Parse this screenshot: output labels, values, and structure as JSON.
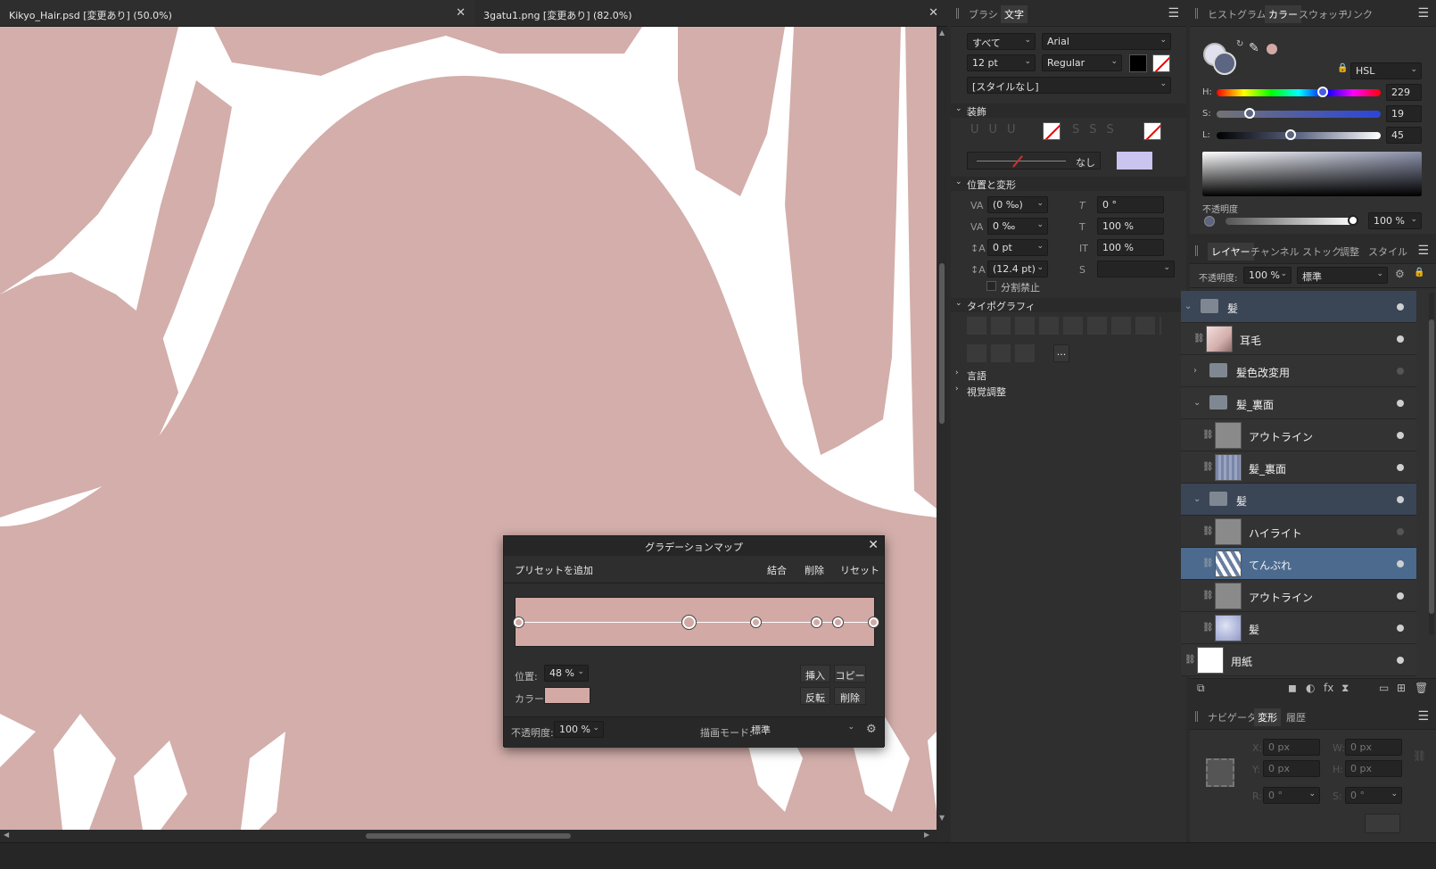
{
  "tabs": [
    {
      "label": "Kikyo_Hair.psd [変更あり] (50.0%)",
      "close": "✕"
    },
    {
      "label": "3gatu1.png [変更あり] (82.0%)",
      "close": "✕"
    }
  ],
  "canvas": {
    "shape_color": "#d3aeaa",
    "bg_color": "#ffffff"
  },
  "text_panel": {
    "tabs": [
      "ブラシ",
      "文字"
    ],
    "active_tab": "文字",
    "scope": "すべて",
    "font": "Arial",
    "size": "12 pt",
    "style": "Regular",
    "paragraph_style": "[スタイルなし]",
    "decoration_header": "装飾",
    "none_label": "なし",
    "position_header": "位置と変形",
    "kerning": "(0 ‰)",
    "tracking": "0 ‰",
    "baseline": "0 pt",
    "leading": "(12.4 pt)",
    "skew": "0 °",
    "hscale": "100 %",
    "vscale": "100 %",
    "no_break": "分割禁止",
    "typography_header": "タイポグラフィ",
    "typo_more": "...",
    "language_header": "言語",
    "visual_header": "視覚調整"
  },
  "color_panel": {
    "tabs": [
      "ヒストグラム",
      "カラー",
      "スウォッチ",
      "リンク"
    ],
    "active_tab": "カラー",
    "model": "HSL",
    "h_label": "H:",
    "h_value": "229",
    "s_label": "S:",
    "s_value": "19",
    "l_label": "L:",
    "l_value": "45",
    "opacity_label": "不透明度",
    "opacity_value": "100 %",
    "fill_color": "#5c6581"
  },
  "layers_panel": {
    "tabs": [
      "レイヤー",
      "チャンネル",
      "ストック",
      "調整",
      "スタイル"
    ],
    "active_tab": "レイヤー",
    "opacity_label": "不透明度:",
    "opacity_value": "100 %",
    "blend_mode": "標準",
    "layers": [
      {
        "name": "髪",
        "type": "group",
        "visible": true
      },
      {
        "name": "耳毛",
        "type": "pixel",
        "visible": true
      },
      {
        "name": "髪色改変用",
        "type": "group",
        "visible": false
      },
      {
        "name": "髪_裏面",
        "type": "group",
        "visible": true
      },
      {
        "name": "アウトライン",
        "type": "pixel",
        "visible": true
      },
      {
        "name": "髪_裏面",
        "type": "pixel",
        "visible": true
      },
      {
        "name": "髪",
        "type": "group",
        "visible": true
      },
      {
        "name": "ハイライト",
        "type": "pixel",
        "visible": false
      },
      {
        "name": "てんぷれ",
        "type": "pixel",
        "visible": true,
        "selected": true
      },
      {
        "name": "アウトライン",
        "type": "pixel",
        "visible": true
      },
      {
        "name": "髪",
        "type": "pixel",
        "visible": true
      },
      {
        "name": "用紙",
        "type": "pixel",
        "visible": true
      }
    ]
  },
  "transform_panel": {
    "tabs": [
      "ナビゲータ",
      "変形",
      "履歴"
    ],
    "active_tab": "変形",
    "x_label": "X:",
    "x_value": "0 px",
    "y_label": "Y:",
    "y_value": "0 px",
    "w_label": "W:",
    "w_value": "0 px",
    "h_label": "H:",
    "h_value": "0 px",
    "r_label": "R:",
    "r_value": "0 °",
    "s_label": "S:",
    "s_value": "0 °"
  },
  "gradient_map": {
    "title": "グラデーションマップ",
    "add_preset": "プリセットを追加",
    "merge": "結合",
    "delete": "削除",
    "reset": "リセット",
    "position_label": "位置:",
    "position_value": "48 %",
    "color_label": "カラー:",
    "color_value": "#d3a9a5",
    "insert": "挿入",
    "copy": "コピー",
    "reverse": "反転",
    "delete2": "削除",
    "opacity_label": "不透明度:",
    "opacity_value": "100 %",
    "blend_label": "描画モード:",
    "blend_value": "標準",
    "stops": [
      0,
      48,
      67,
      84,
      90,
      100
    ]
  }
}
